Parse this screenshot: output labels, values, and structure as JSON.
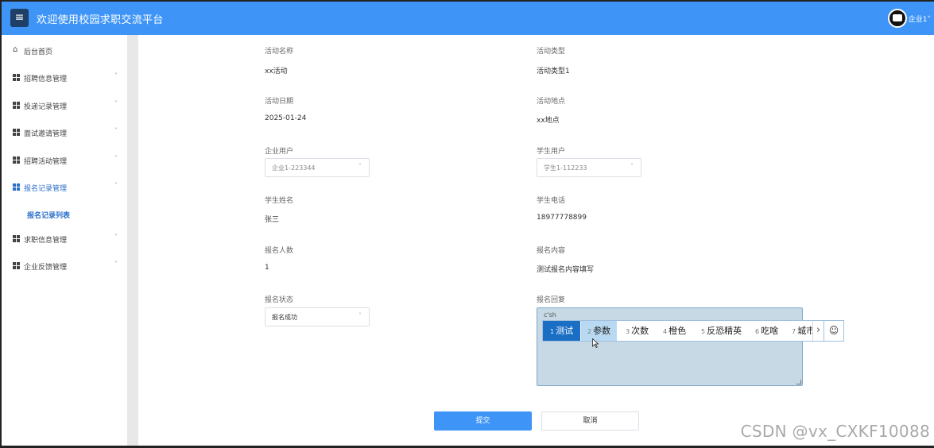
{
  "header": {
    "menu_icon": "hamburger-icon",
    "title": "欢迎使用校园求职交流平台",
    "user_name": "企业1",
    "user_chevron": "˅"
  },
  "sidebar": {
    "items": [
      {
        "label": "后台首页",
        "icon": "home-icon",
        "chevron": ""
      },
      {
        "label": "招聘信息管理",
        "icon": "grid-icon",
        "chevron": "˅"
      },
      {
        "label": "投递记录管理",
        "icon": "grid-icon",
        "chevron": "˅"
      },
      {
        "label": "面试邀请管理",
        "icon": "grid-icon",
        "chevron": "˅"
      },
      {
        "label": "招聘活动管理",
        "icon": "grid-icon",
        "chevron": "˅"
      },
      {
        "label": "报名记录管理",
        "icon": "grid-icon",
        "chevron": "˄",
        "active": true
      },
      {
        "label": "求职信息管理",
        "icon": "grid-icon",
        "chevron": "˅"
      },
      {
        "label": "企业反馈管理",
        "icon": "grid-icon",
        "chevron": "˅"
      }
    ],
    "sub_item": "报名记录列表"
  },
  "form": {
    "activity_name_label": "活动名称",
    "activity_name_value": "xx活动",
    "activity_type_label": "活动类型",
    "activity_type_value": "活动类型1",
    "activity_date_label": "活动日期",
    "activity_date_value": "2025-01-24",
    "activity_place_label": "活动地点",
    "activity_place_value": "xx地点",
    "company_user_label": "企业用户",
    "company_user_value": "企业1-223344",
    "student_user_label": "学生用户",
    "student_user_value": "学生1-112233",
    "student_name_label": "学生姓名",
    "student_name_value": "张三",
    "student_phone_label": "学生电话",
    "student_phone_value": "18977778899",
    "signup_count_label": "报名人数",
    "signup_count_value": "1",
    "signup_content_label": "报名内容",
    "signup_content_value": "测试报名内容填写",
    "signup_status_label": "报名状态",
    "signup_status_value": "报名成功",
    "signup_reply_label": "报名回复",
    "signup_reply_value": "c'sh",
    "select_chevron": "˅"
  },
  "ime": {
    "candidates": [
      {
        "num": "1",
        "text": "测试"
      },
      {
        "num": "2",
        "text": "参数"
      },
      {
        "num": "3",
        "text": "次数"
      },
      {
        "num": "4",
        "text": "橙色"
      },
      {
        "num": "5",
        "text": "反恐精英"
      },
      {
        "num": "6",
        "text": "吃啥"
      },
      {
        "num": "7",
        "text": "城市"
      }
    ],
    "next_icon": "chevron-right-icon",
    "emoji_icon": "smiley-icon"
  },
  "buttons": {
    "submit": "提交",
    "cancel": "取消"
  },
  "watermark": "CSDN @vx_CXKF10088",
  "colors": {
    "header": "#3e95f7",
    "accent": "#2a6fc9",
    "ime_selected": "#1a6fc4"
  }
}
